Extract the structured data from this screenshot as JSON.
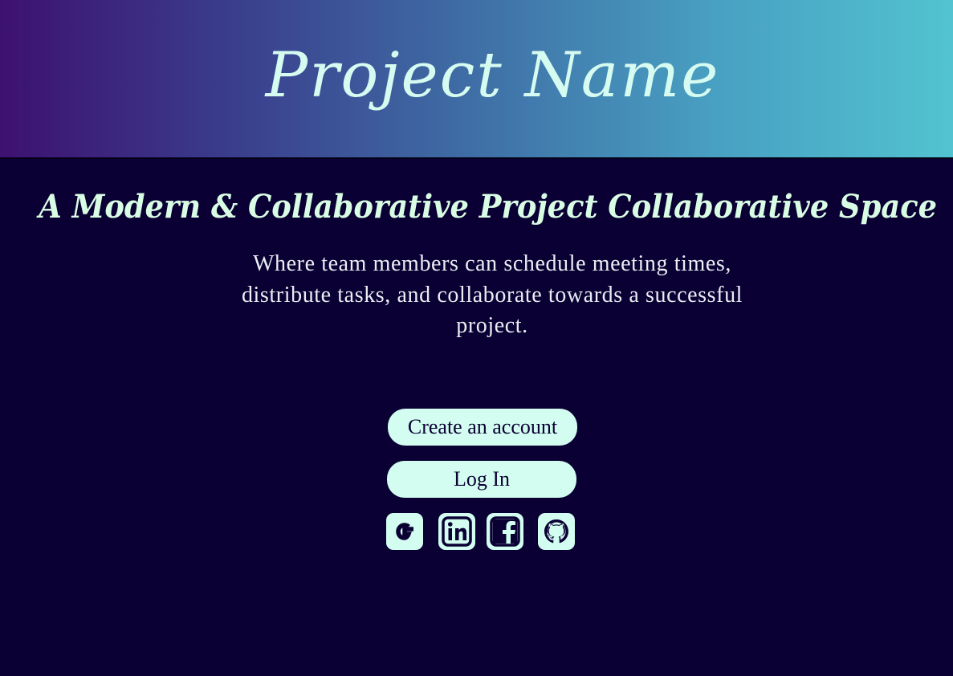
{
  "header": {
    "title": "Project Name"
  },
  "hero": {
    "tagline": "A Modern & Collaborative Project Collaborative Space",
    "description": "Where team members can schedule meeting times, distribute tasks, and collaborate towards a successful project."
  },
  "actions": {
    "create_account_label": "Create an account",
    "login_label": "Log In"
  },
  "social_logins": [
    {
      "icon": "google-icon"
    },
    {
      "icon": "linkedin-icon"
    },
    {
      "icon": "facebook-icon"
    },
    {
      "icon": "github-icon"
    }
  ],
  "colors": {
    "background": "#0b0033",
    "header_gradient_start": "#3d1170",
    "header_gradient_end": "#52c3d0",
    "accent": "#d2fdf0",
    "title_text": "#d6fbf0"
  }
}
